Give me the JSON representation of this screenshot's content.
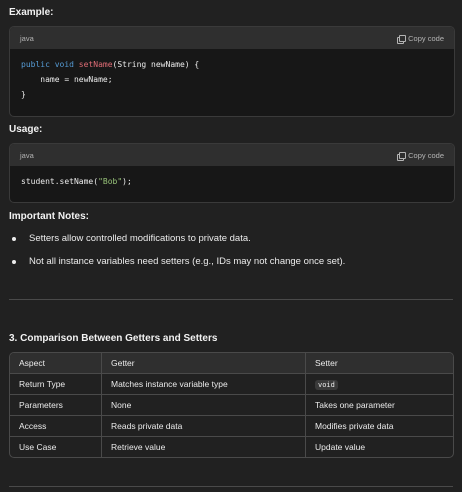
{
  "example": {
    "heading": "Example:",
    "lang": "java",
    "copy_label": "Copy code",
    "lines": [
      {
        "kw": "public void ",
        "fn": "setName",
        "rest": "(String newName) {"
      },
      {
        "text": "    name = newName;"
      },
      {
        "text": "}"
      }
    ]
  },
  "usage": {
    "heading": "Usage:",
    "lang": "java",
    "copy_label": "Copy code",
    "code_prefix": "student.setName(",
    "code_string": "\"Bob\"",
    "code_suffix": ");"
  },
  "notes": {
    "heading": "Important Notes:",
    "items": [
      "Setters allow controlled modifications to private data.",
      "Not all instance variables need setters (e.g., IDs may not change once set)."
    ]
  },
  "comparison": {
    "heading": "3. Comparison Between Getters and Setters",
    "columns": [
      "Aspect",
      "Getter",
      "Setter"
    ],
    "rows": [
      [
        "Return Type",
        "Matches instance variable type",
        "void"
      ],
      [
        "Parameters",
        "None",
        "Takes one parameter"
      ],
      [
        "Access",
        "Reads private data",
        "Modifies private data"
      ],
      [
        "Use Case",
        "Retrieve value",
        "Update value"
      ]
    ]
  }
}
